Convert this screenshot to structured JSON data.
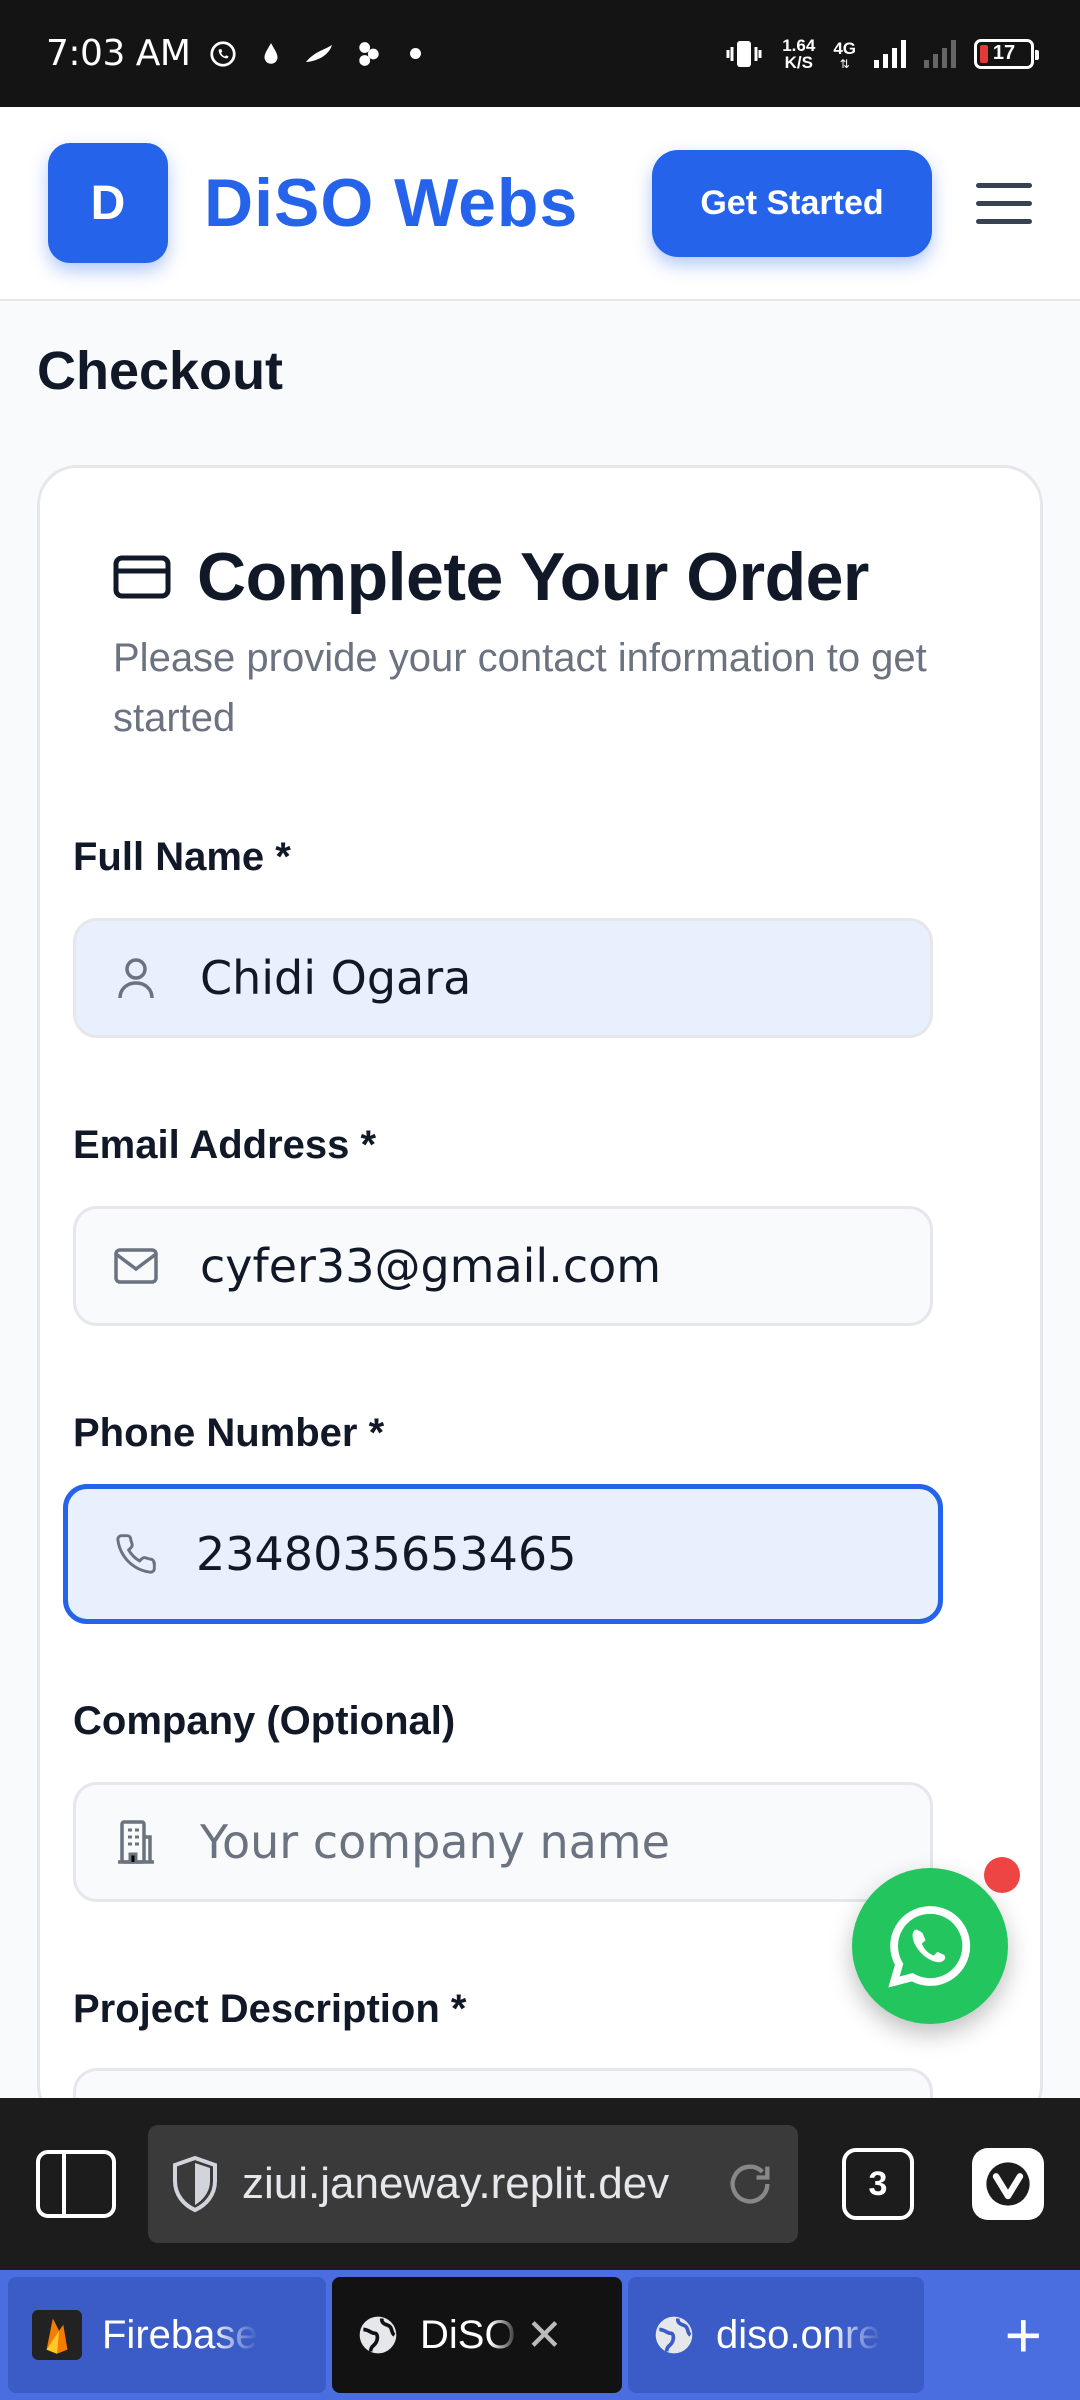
{
  "status_bar": {
    "time": "7:03 AM",
    "speed_value": "1.64",
    "speed_unit": "K/S",
    "network": "4G",
    "battery": "17"
  },
  "header": {
    "logo_letter": "D",
    "brand": "DiSO Webs",
    "cta_label": "Get Started"
  },
  "page": {
    "title": "Checkout"
  },
  "card": {
    "title": "Complete Your Order",
    "subtitle": "Please provide your contact information to get started",
    "fields": {
      "full_name": {
        "label": "Full Name *",
        "value": "Chidi Ogara"
      },
      "email": {
        "label": "Email Address *",
        "value": "cyfer33@gmail.com"
      },
      "phone": {
        "label": "Phone Number *",
        "value": "2348035653465"
      },
      "company": {
        "label": "Company (Optional)",
        "value": "",
        "placeholder": "Your company name"
      },
      "project": {
        "label": "Project Description *"
      }
    }
  },
  "browser": {
    "url": "ziui.janeway.replit.dev",
    "tab_count": "3",
    "tabs": [
      {
        "label": "Firebase",
        "active": false
      },
      {
        "label": "DiSO W",
        "active": true
      },
      {
        "label": "diso.onre",
        "active": false
      }
    ]
  },
  "colors": {
    "primary": "#2563eb",
    "whatsapp": "#22c55e",
    "tab_strip": "#4a6ee0"
  }
}
